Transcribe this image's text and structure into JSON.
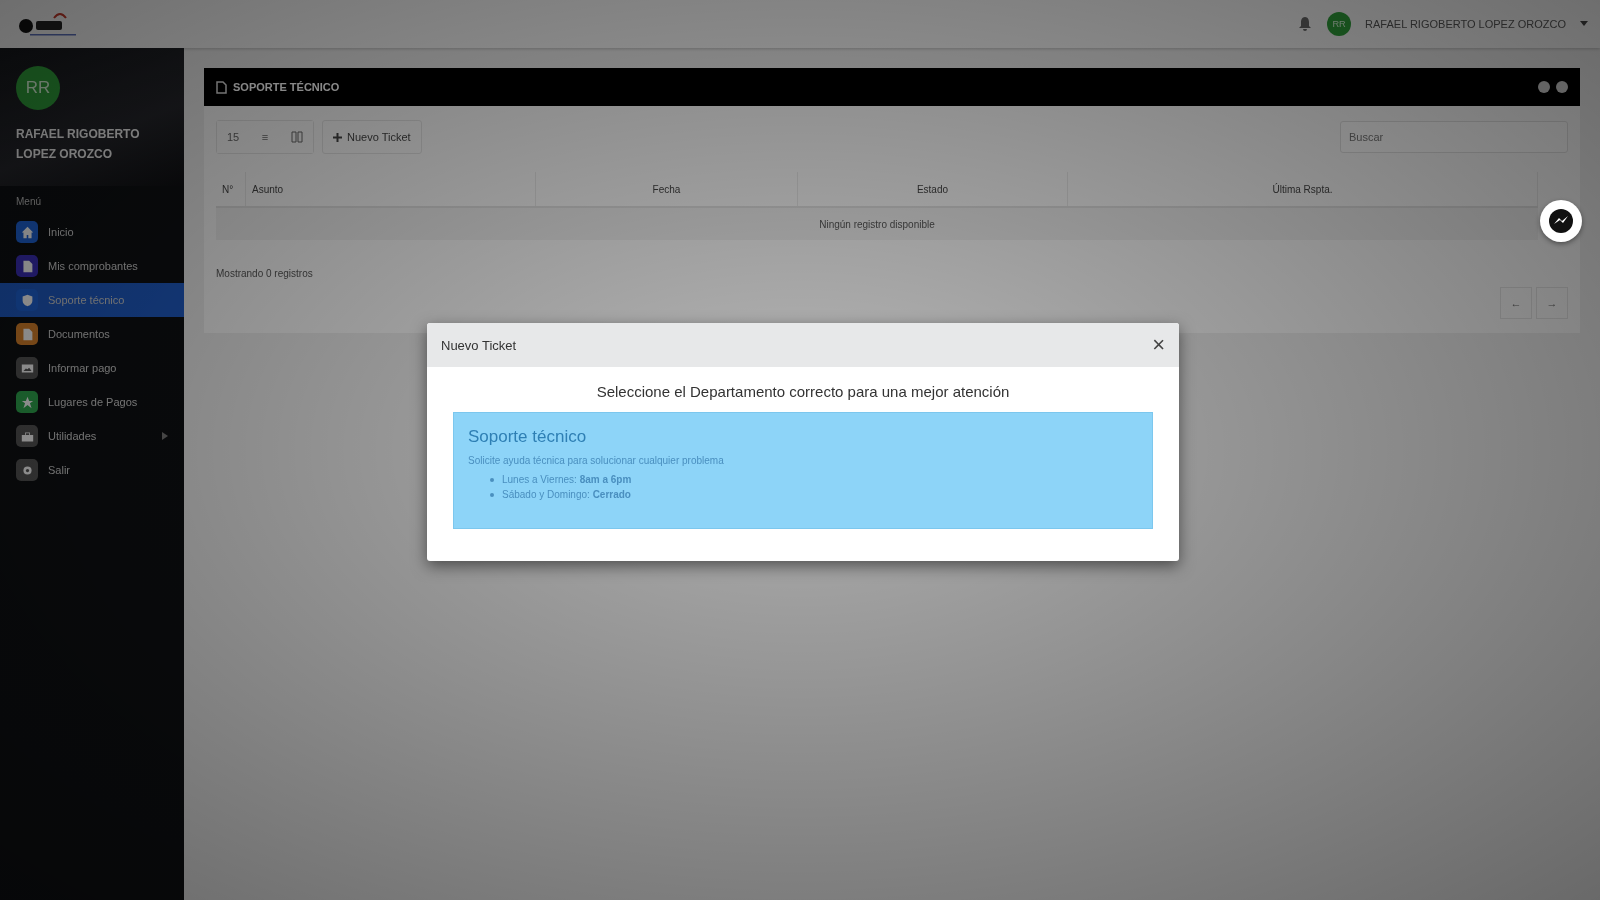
{
  "topbar": {
    "user_initials": "RR",
    "user_name": "RAFAEL RIGOBERTO LOPEZ OROZCO"
  },
  "sidebar": {
    "initials": "RR",
    "name": "RAFAEL RIGOBERTO LOPEZ OROZCO",
    "section": "Menú",
    "items": [
      {
        "label": "Inicio",
        "kind": "home",
        "selected": false,
        "submenu": false
      },
      {
        "label": "Mis comprobantes",
        "kind": "receipt",
        "selected": false,
        "submenu": false
      },
      {
        "label": "Soporte técnico",
        "kind": "shield",
        "selected": true,
        "submenu": false
      },
      {
        "label": "Documentos",
        "kind": "document",
        "selected": false,
        "submenu": false
      },
      {
        "label": "Informar pago",
        "kind": "image",
        "selected": false,
        "submenu": false
      },
      {
        "label": "Lugares de Pagos",
        "kind": "star",
        "selected": false,
        "submenu": false
      },
      {
        "label": "Utilidades",
        "kind": "box",
        "selected": false,
        "submenu": true
      },
      {
        "label": "Salir",
        "kind": "gear",
        "selected": false,
        "submenu": false
      }
    ]
  },
  "panel": {
    "title": "SOPORTE TÉCNICO",
    "toolbar": [
      {
        "label": "15",
        "kind": "text"
      },
      {
        "label": "≡",
        "kind": "text"
      },
      {
        "kind": "columns"
      }
    ],
    "new_button": "Nuevo Ticket",
    "search": {
      "placeholder": "Buscar"
    },
    "table": {
      "columns": [
        "N°",
        "Asunto",
        "Fecha",
        "Estado",
        "Última Rspta."
      ],
      "empty": "Ningún registro disponible"
    },
    "footer": "Mostrando 0 registros",
    "pagination": [
      "←",
      "→"
    ]
  },
  "modal": {
    "title": "Nuevo Ticket",
    "close": "×",
    "heading": "Seleccione el Departamento correcto para una mejor atención",
    "departments": [
      {
        "title": "Soporte técnico",
        "description": "Solicite ayuda técnica para solucionar cualquier problema",
        "hours": [
          "Lunes a Viernes: **8am a 6pm**",
          "Sábado y Domingo: **Cerrado**"
        ]
      }
    ]
  }
}
